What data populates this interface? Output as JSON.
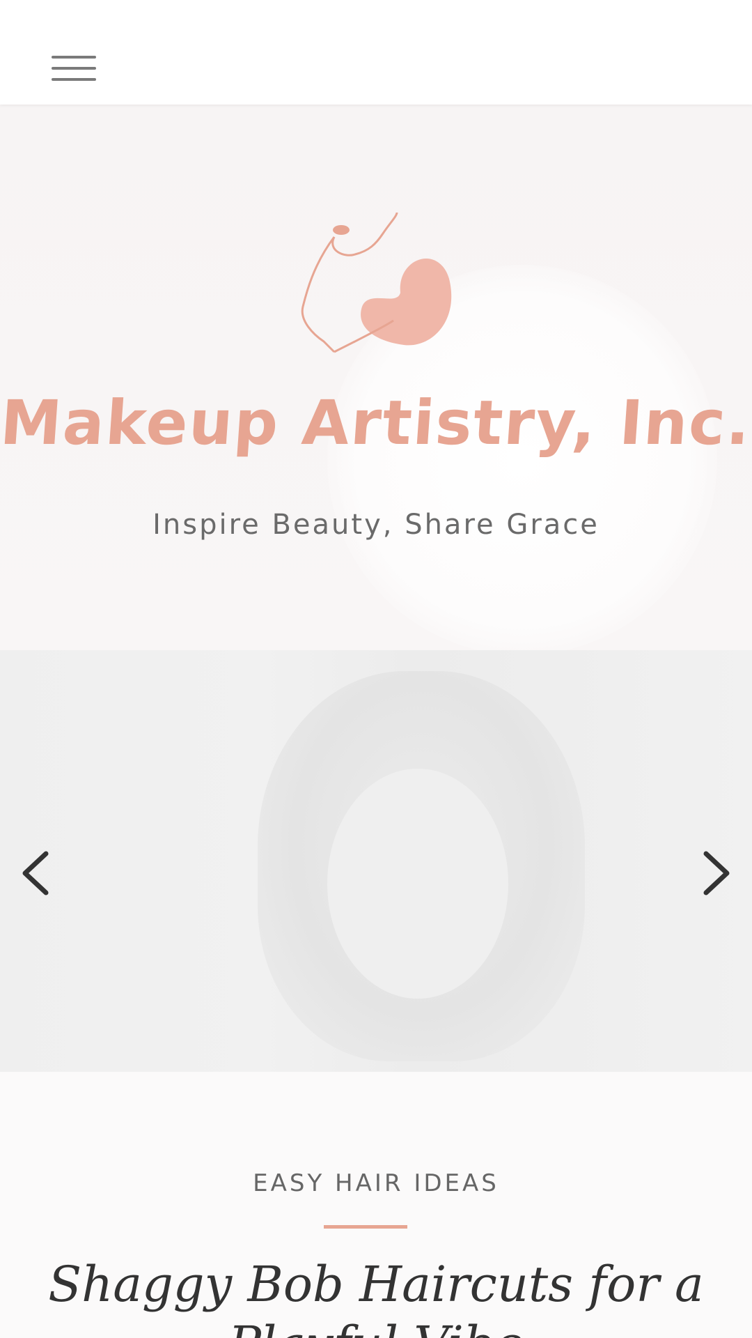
{
  "header": {
    "brand_name": "Makeup Artistry, Inc.",
    "tagline": "Inspire Beauty, Share Grace",
    "brand_color": "#e7a592"
  },
  "nav": {
    "menu_icon": "hamburger-menu-icon"
  },
  "slider": {
    "prev_icon": "chevron-left-icon",
    "next_icon": "chevron-right-icon"
  },
  "post": {
    "category": "EASY HAIR IDEAS",
    "title": "Shaggy Bob Haircuts for a Playful Vibe"
  }
}
